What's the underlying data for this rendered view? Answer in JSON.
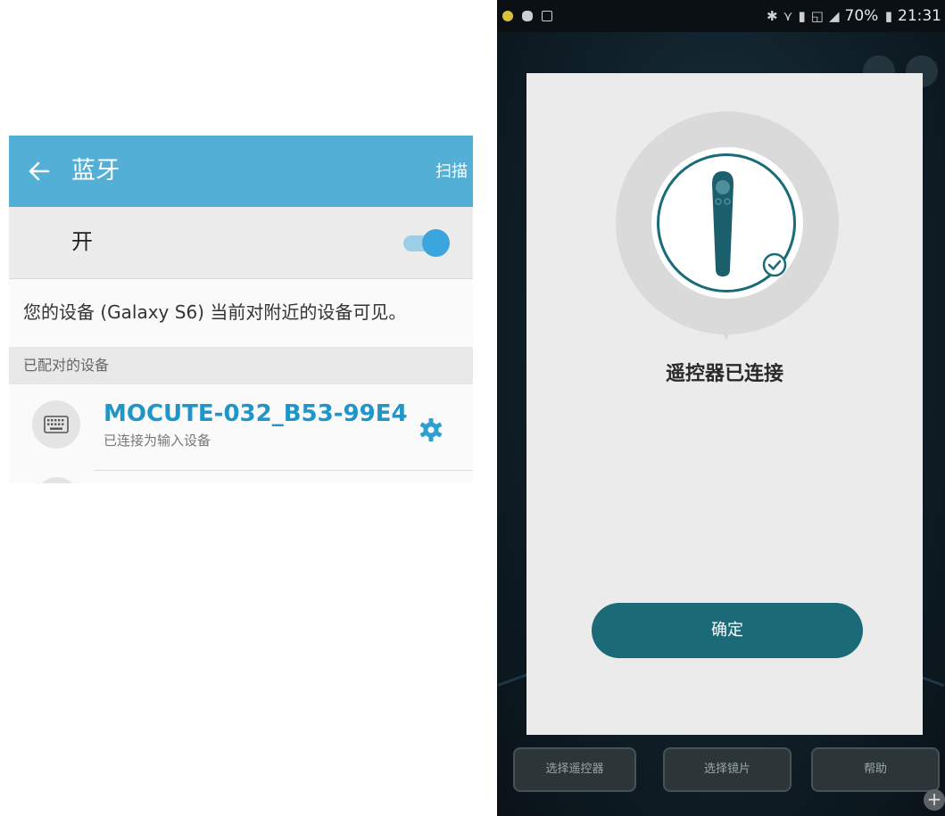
{
  "bluetooth": {
    "title": "蓝牙",
    "scan": "扫描",
    "toggle_label": "开",
    "toggle_on": true,
    "visible_text": "您的设备 (Galaxy S6) 当前对附近的设备可见。",
    "section_paired": "已配对的设备",
    "device": {
      "name": "MOCUTE-032_B53-99E4",
      "status": "已连接为输入设备",
      "icon": "keyboard-icon"
    },
    "colors": {
      "header": "#53afd6",
      "device_name": "#1f95c8",
      "switch": "#3aa6dd"
    }
  },
  "phone": {
    "status_bar": {
      "battery": "70%",
      "time": "21:31",
      "icons": [
        "bluetooth-icon",
        "vibrate-icon",
        "sim-icon",
        "data-icon",
        "signal-icon"
      ]
    },
    "dialog": {
      "title": "遥控器已连接",
      "ok": "确定",
      "accent": "#1b6a78"
    },
    "bottom_buttons": [
      "选择遥控器",
      "选择镜片",
      "帮助"
    ],
    "plus": "+"
  }
}
